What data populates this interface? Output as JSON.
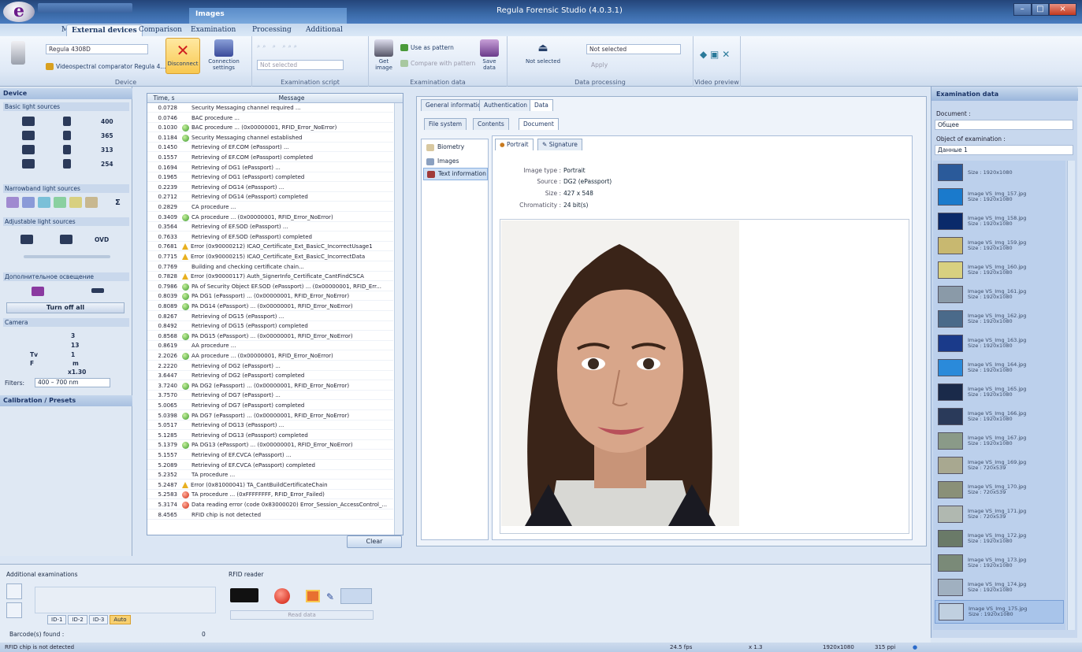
{
  "window_title": "Regula Forensic Studio (4.0.3.1)",
  "app_logo": "e",
  "context_tab": "Images",
  "tabs": [
    {
      "label": "Main",
      "active": false
    },
    {
      "label": "External devices",
      "active": true
    },
    {
      "label": "Comparison",
      "active": false
    },
    {
      "label": "Examination",
      "active": false
    },
    {
      "label": "Processing",
      "active": false
    },
    {
      "label": "Additional",
      "active": false
    }
  ],
  "ribbon": {
    "device_combo": "Regula 4308D",
    "device_item": "Videospectral comparator Regula 4...",
    "disconnect_label": "Disconnect",
    "connection_label": "Connection settings",
    "not_selected_combo": "Not selected",
    "get_image_label": "Get image",
    "use_pattern_label": "Use as pattern",
    "compare_pattern_label": "Compare with pattern",
    "save_data_label": "Save data",
    "not_selected_big": "Not selected",
    "processing_combo": "Not selected",
    "apply_label": "Apply",
    "groups": {
      "device": "Device",
      "exam_script": "Examination script",
      "exam_data": "Examination data",
      "data_processing": "Data processing",
      "video_preview": "Video preview"
    }
  },
  "left_panel": {
    "title": "Device",
    "basic_light": "Basic light sources",
    "basic_values": [
      "400",
      "365",
      "313",
      "254"
    ],
    "narrowband": "Narrowband light sources",
    "sigma": "Σ",
    "adjustable": "Adjustable light sources",
    "ovd": "OVD",
    "additional_lighting": "Дополнительное освещение",
    "turn_off_all": "Turn off all",
    "camera": "Camera",
    "camera_values": [
      "3",
      "13",
      "1",
      "m",
      "x1.30"
    ],
    "camera_symbols": [
      "Tv",
      "F"
    ],
    "filters_label": "Filters:",
    "filters_value": "400 – 700 nm",
    "calibration": "Calibration / Presets"
  },
  "log": {
    "col_time": "Time, s",
    "col_message": "Message",
    "rows": [
      {
        "t": "0.0728",
        "icon": "none",
        "m": "Security Messaging channel required ..."
      },
      {
        "t": "0.0746",
        "icon": "none",
        "m": "BAC procedure ..."
      },
      {
        "t": "0.1030",
        "icon": "ok",
        "m": "BAC procedure ... (0x00000001, RFID_Error_NoError)"
      },
      {
        "t": "0.1184",
        "icon": "ok",
        "m": "Security Messaging channel established"
      },
      {
        "t": "0.1450",
        "icon": "none",
        "m": "Retrieving of EF.COM (ePassport) ..."
      },
      {
        "t": "0.1557",
        "icon": "none",
        "m": "Retrieving of EF.COM (ePassport) completed"
      },
      {
        "t": "0.1694",
        "icon": "none",
        "m": "Retrieving of DG1 (ePassport) ..."
      },
      {
        "t": "0.1965",
        "icon": "none",
        "m": "Retrieving of DG1 (ePassport) completed"
      },
      {
        "t": "0.2239",
        "icon": "none",
        "m": "Retrieving of DG14 (ePassport) ..."
      },
      {
        "t": "0.2712",
        "icon": "none",
        "m": "Retrieving of DG14 (ePassport) completed"
      },
      {
        "t": "0.2829",
        "icon": "none",
        "m": "CA procedure ..."
      },
      {
        "t": "0.3409",
        "icon": "ok",
        "m": "CA procedure ... (0x00000001, RFID_Error_NoError)"
      },
      {
        "t": "0.3564",
        "icon": "none",
        "m": "Retrieving of EF.SOD (ePassport) ..."
      },
      {
        "t": "0.7633",
        "icon": "none",
        "m": "Retrieving of EF.SOD (ePassport) completed"
      },
      {
        "t": "0.7681",
        "icon": "warn",
        "m": "Error (0x90000212) ICAO_Certificate_Ext_BasicC_IncorrectUsage1"
      },
      {
        "t": "0.7715",
        "icon": "warn",
        "m": "Error (0x90000215) ICAO_Certificate_Ext_BasicC_IncorrectData"
      },
      {
        "t": "0.7769",
        "icon": "none",
        "m": "Building and checking certificate chain..."
      },
      {
        "t": "0.7828",
        "icon": "warn",
        "m": "Error (0x90000117) Auth_SignerInfo_Certificate_CantFindCSCA"
      },
      {
        "t": "0.7986",
        "icon": "ok",
        "m": "PA of Security Object EF.SOD (ePassport) ... (0x00000001, RFID_Err..."
      },
      {
        "t": "0.8039",
        "icon": "ok",
        "m": "PA DG1 (ePassport) ... (0x00000001, RFID_Error_NoError)"
      },
      {
        "t": "0.8089",
        "icon": "ok",
        "m": "PA DG14 (ePassport) ... (0x00000001, RFID_Error_NoError)"
      },
      {
        "t": "0.8267",
        "icon": "none",
        "m": "Retrieving of DG15 (ePassport) ..."
      },
      {
        "t": "0.8492",
        "icon": "none",
        "m": "Retrieving of DG15 (ePassport) completed"
      },
      {
        "t": "0.8568",
        "icon": "ok",
        "m": "PA DG15 (ePassport) ... (0x00000001, RFID_Error_NoError)"
      },
      {
        "t": "0.8619",
        "icon": "none",
        "m": "AA procedure ..."
      },
      {
        "t": "2.2026",
        "icon": "ok",
        "m": "AA procedure ... (0x00000001, RFID_Error_NoError)"
      },
      {
        "t": "2.2220",
        "icon": "none",
        "m": "Retrieving of DG2 (ePassport) ..."
      },
      {
        "t": "3.6447",
        "icon": "none",
        "m": "Retrieving of DG2 (ePassport) completed"
      },
      {
        "t": "3.7240",
        "icon": "ok",
        "m": "PA DG2 (ePassport) ... (0x00000001, RFID_Error_NoError)"
      },
      {
        "t": "3.7570",
        "icon": "none",
        "m": "Retrieving of DG7 (ePassport) ..."
      },
      {
        "t": "5.0065",
        "icon": "none",
        "m": "Retrieving of DG7 (ePassport) completed"
      },
      {
        "t": "5.0398",
        "icon": "ok",
        "m": "PA DG7 (ePassport) ... (0x00000001, RFID_Error_NoError)"
      },
      {
        "t": "5.0517",
        "icon": "none",
        "m": "Retrieving of DG13 (ePassport) ..."
      },
      {
        "t": "5.1285",
        "icon": "none",
        "m": "Retrieving of DG13 (ePassport) completed"
      },
      {
        "t": "5.1379",
        "icon": "ok",
        "m": "PA DG13 (ePassport) ... (0x00000001, RFID_Error_NoError)"
      },
      {
        "t": "5.1557",
        "icon": "none",
        "m": "Retrieving of EF.CVCA (ePassport) ..."
      },
      {
        "t": "5.2089",
        "icon": "none",
        "m": "Retrieving of EF.CVCA (ePassport) completed"
      },
      {
        "t": "5.2352",
        "icon": "none",
        "m": "TA procedure ..."
      },
      {
        "t": "5.2487",
        "icon": "warn",
        "m": "Error (0x81000041) TA_CantBuildCertificateChain"
      },
      {
        "t": "5.2583",
        "icon": "err",
        "m": "TA procedure ... (0xFFFFFFFF, RFID_Error_Failed)"
      },
      {
        "t": "5.3174",
        "icon": "err",
        "m": "Data reading error (code 0x83000020) Error_Session_AccessControl_..."
      },
      {
        "t": "8.4565",
        "icon": "none",
        "m": "RFID chip is not detected"
      }
    ],
    "clear_label": "Clear"
  },
  "doc": {
    "tabs": [
      "General information",
      "Authentication",
      "Data"
    ],
    "subtabs": [
      "File system",
      "Contents",
      "Document"
    ],
    "tree": [
      "Biometry",
      "Images",
      "Text information"
    ],
    "img_tabs": [
      "Portrait",
      "Signature"
    ],
    "info": [
      {
        "k": "Image type :",
        "v": "Portrait"
      },
      {
        "k": "Source :",
        "v": "DG2 (ePassport)"
      },
      {
        "k": "Size :",
        "v": "427 x 548"
      },
      {
        "k": "Chromaticity :",
        "v": "24 bit(s)"
      }
    ]
  },
  "right_panel": {
    "title": "Examination data",
    "document_label": "Document :",
    "document_value": "Общее",
    "object_label": "Object of examination :",
    "object_value": "Данные 1",
    "thumbs": [
      {
        "name": "",
        "size": "Size : 1920x1080",
        "color": "#2a5a9a"
      },
      {
        "name": "Image VS_Img_157.jpg",
        "size": "Size : 1920x1080",
        "color": "#1a7acc"
      },
      {
        "name": "Image VS_Img_158.jpg",
        "size": "Size : 1920x1080",
        "color": "#0a2a6a"
      },
      {
        "name": "Image VS_Img_159.jpg",
        "size": "Size : 1920x1080",
        "color": "#c8b870"
      },
      {
        "name": "Image VS_Img_160.jpg",
        "size": "Size : 1920x1080",
        "color": "#d8d080"
      },
      {
        "name": "Image VS_Img_161.jpg",
        "size": "Size : 1920x1080",
        "color": "#8a9aa8"
      },
      {
        "name": "Image VS_Img_162.jpg",
        "size": "Size : 1920x1080",
        "color": "#4a6a8a"
      },
      {
        "name": "Image VS_Img_163.jpg",
        "size": "Size : 1920x1080",
        "color": "#1a3a8a"
      },
      {
        "name": "Image VS_Img_164.jpg",
        "size": "Size : 1920x1080",
        "color": "#2a8ada"
      },
      {
        "name": "Image VS_Img_165.jpg",
        "size": "Size : 1920x1080",
        "color": "#1a2a4a"
      },
      {
        "name": "Image VS_Img_166.jpg",
        "size": "Size : 1920x1080",
        "color": "#2a3a5a"
      },
      {
        "name": "Image VS_Img_167.jpg",
        "size": "Size : 1920x1080",
        "color": "#8a9a88"
      },
      {
        "name": "Image VS_Img_169.jpg",
        "size": "Size : 720x539",
        "color": "#a8a890"
      },
      {
        "name": "Image VS_Img_170.jpg",
        "size": "Size : 720x539",
        "color": "#8a9078"
      },
      {
        "name": "Image VS_Img_171.jpg",
        "size": "Size : 720x539",
        "color": "#b0b8b0"
      },
      {
        "name": "Image VS_Img_172.jpg",
        "size": "Size : 1920x1080",
        "color": "#6a7a68"
      },
      {
        "name": "Image VS_Img_173.jpg",
        "size": "Size : 1920x1080",
        "color": "#7a8a78"
      },
      {
        "name": "Image VS_Img_174.jpg",
        "size": "Size : 1920x1080",
        "color": "#a0b0c0"
      },
      {
        "name": "Image VS_Img_175.jpg",
        "size": "Size : 1920x1080",
        "color": "#c0d0e0"
      }
    ]
  },
  "bottom": {
    "additional_exams": "Additional examinations",
    "rfid_reader": "RFID reader",
    "read_data": "Read data",
    "id_buttons": [
      "ID-1",
      "ID-2",
      "ID-3",
      "Auto"
    ],
    "barcode_label": "Barcode(s) found :",
    "barcode_count": "0"
  },
  "status": {
    "left": "RFID chip is not detected",
    "fps": "24.5 fps",
    "zoom": "x 1.3",
    "resolution": "1920x1080",
    "ppi": "315 ppi"
  }
}
